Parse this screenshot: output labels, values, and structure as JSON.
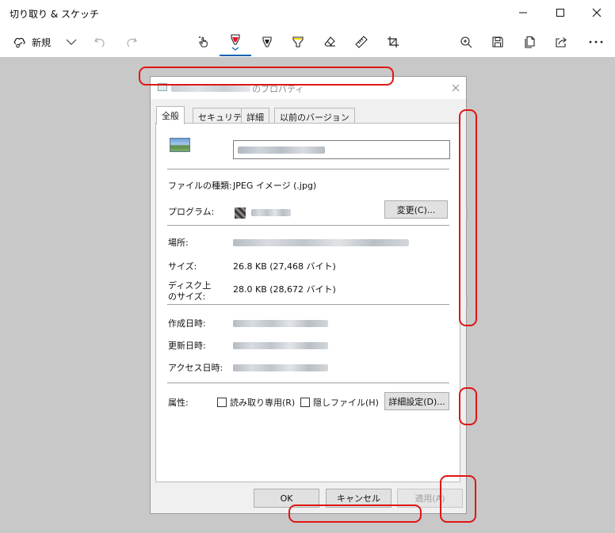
{
  "app": {
    "title": "切り取り & スケッチ"
  },
  "toolbar": {
    "new_label": "新規"
  },
  "dialog": {
    "title_suffix": "のプロパティ",
    "tabs": [
      "全般",
      "セキュリティ",
      "詳細",
      "以前のバージョン"
    ],
    "rows": {
      "file_type_label": "ファイルの種類:",
      "file_type_value": "JPEG イメージ (.jpg)",
      "program_label": "プログラム:",
      "change_button": "変更(C)...",
      "location_label": "場所:",
      "size_label": "サイズ:",
      "size_value": "26.8 KB (27,468 バイト)",
      "disk_size_label_1": "ディスク上",
      "disk_size_label_2": "のサイズ:",
      "disk_size_value": "28.0 KB (28,672 バイト)",
      "created_label": "作成日時:",
      "modified_label": "更新日時:",
      "accessed_label": "アクセス日時:",
      "attributes_label": "属性:",
      "readonly_label": "読み取り専用(R)",
      "hidden_label": "隠しファイル(H)",
      "advanced_button": "詳細設定(D)..."
    },
    "buttons": {
      "ok": "OK",
      "cancel": "キャンセル",
      "apply": "適用(A)"
    }
  },
  "colors": {
    "annotation_red": "#e01515",
    "canvas_gray": "#c8c8c8",
    "accent_blue": "#0063b1",
    "pen_red": "#e81123",
    "highlighter_yellow": "#ffd800"
  },
  "icons": [
    "minimize-icon",
    "maximize-icon",
    "close-icon",
    "new-snip-icon",
    "chevron-down-icon",
    "undo-icon",
    "redo-icon",
    "touch-writing-icon",
    "ballpoint-pen-icon",
    "pencil-icon",
    "highlighter-icon",
    "eraser-icon",
    "ruler-icon",
    "crop-icon",
    "zoom-in-icon",
    "save-icon",
    "copy-icon",
    "share-icon",
    "more-icon"
  ]
}
